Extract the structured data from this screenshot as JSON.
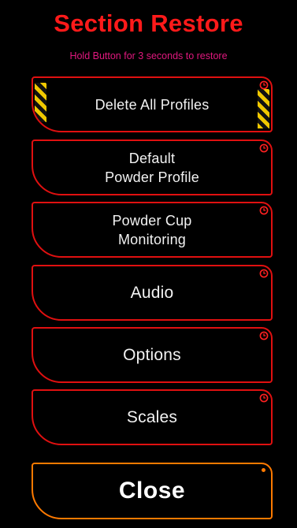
{
  "header": {
    "title": "Section Restore",
    "subtitle": "Hold Button for 3 seconds to restore"
  },
  "buttons": [
    {
      "label": "Delete All Profiles",
      "icon": "clock-icon",
      "hazard_stripes": true
    },
    {
      "label": "Default\nPowder Profile",
      "icon": "clock-icon"
    },
    {
      "label": "Powder Cup\nMonitoring",
      "icon": "clock-icon"
    },
    {
      "label": "Audio",
      "icon": "clock-icon"
    },
    {
      "label": "Options",
      "icon": "clock-icon"
    },
    {
      "label": "Scales",
      "icon": "clock-icon"
    }
  ],
  "close": {
    "label": "Close"
  },
  "colors": {
    "background": "#000000",
    "title": "#ff1a1a",
    "subtitle": "#e0187e",
    "button_border": "#e01010",
    "close_border": "#ff7a00",
    "hazard_yellow": "#f0c800"
  }
}
